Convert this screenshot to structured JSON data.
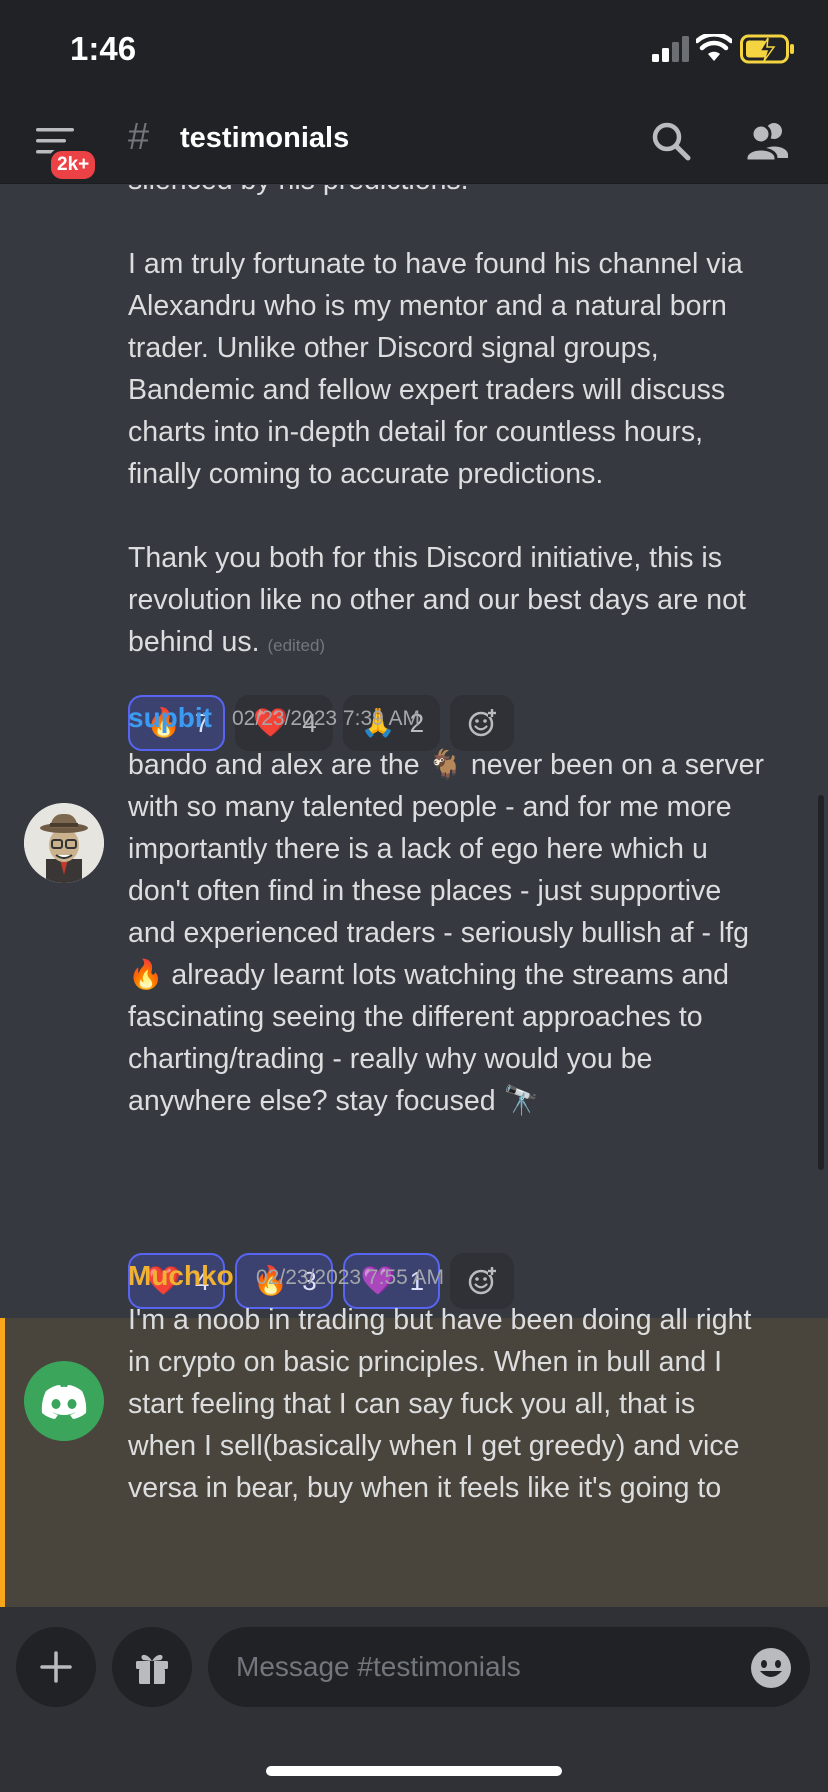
{
  "status_bar": {
    "time": "1:46"
  },
  "header": {
    "badge": "2k+",
    "hash": "#",
    "channel_name": "testimonials"
  },
  "messages": [
    {
      "continued": true,
      "lines": [
        "silenced by his predictions.",
        "",
        "I am truly fortunate to have found his channel via",
        "Alexandru who is my mentor and a natural born",
        "trader. Unlike other Discord signal groups,",
        "Bandemic and fellow expert traders will discuss",
        "charts into in-depth detail for countless hours,",
        "finally coming to accurate predictions.",
        "",
        "Thank you both for this Discord initiative, this is",
        "revolution like no other and our best days are not",
        "behind us."
      ],
      "edited": "(edited)",
      "reactions": [
        {
          "emoji": "🔥",
          "count": "7",
          "active": true
        },
        {
          "emoji": "❤️",
          "count": "4",
          "active": false
        },
        {
          "emoji": "🙏",
          "count": "2",
          "active": false
        }
      ]
    },
    {
      "username": "supbit",
      "username_color": "#3b9bf0",
      "timestamp": "02/23/2023 7:39 AM",
      "lines": [
        "bando and alex are the 🐐 never been on a server",
        "with so many talented people - and for me more",
        "importantly there is a lack of ego here which u",
        "don't often find in these places - just supportive",
        "and experienced traders - seriously bullish af - lfg",
        "🔥 already learnt lots watching the streams and",
        "fascinating seeing the different approaches to",
        "charting/trading - really why would you be",
        "anywhere else? stay focused 🔭"
      ],
      "reactions": [
        {
          "emoji": "❤️",
          "count": "4",
          "active": true
        },
        {
          "emoji": "🔥",
          "count": "3",
          "active": true
        },
        {
          "emoji": "💜",
          "count": "1",
          "active": true
        }
      ]
    },
    {
      "username": "Muchko",
      "username_color": "#f0b232",
      "timestamp": "02/23/2023 7:55 AM",
      "lines": [
        "I'm a noob in trading but have been doing all right",
        "in crypto on basic principles. When in bull and I",
        "start feeling that I can say fuck you all, that is",
        "when I sell(basically when I get greedy) and vice",
        "versa in bear, buy when it feels like it's going to"
      ]
    }
  ],
  "composer": {
    "placeholder": "Message #testimonials"
  },
  "colors": {
    "background": "#36393f",
    "header": "#202225",
    "mention_highlight": "#49443c",
    "mention_bar": "#faa61a",
    "reaction_active_border": "#5865f2",
    "badge": "#ed4245",
    "discord_green": "#3ba55c"
  },
  "icons": [
    "menu-icon",
    "search-icon",
    "members-icon",
    "add-icon",
    "gift-icon",
    "emoji-icon",
    "add-reaction-icon"
  ]
}
